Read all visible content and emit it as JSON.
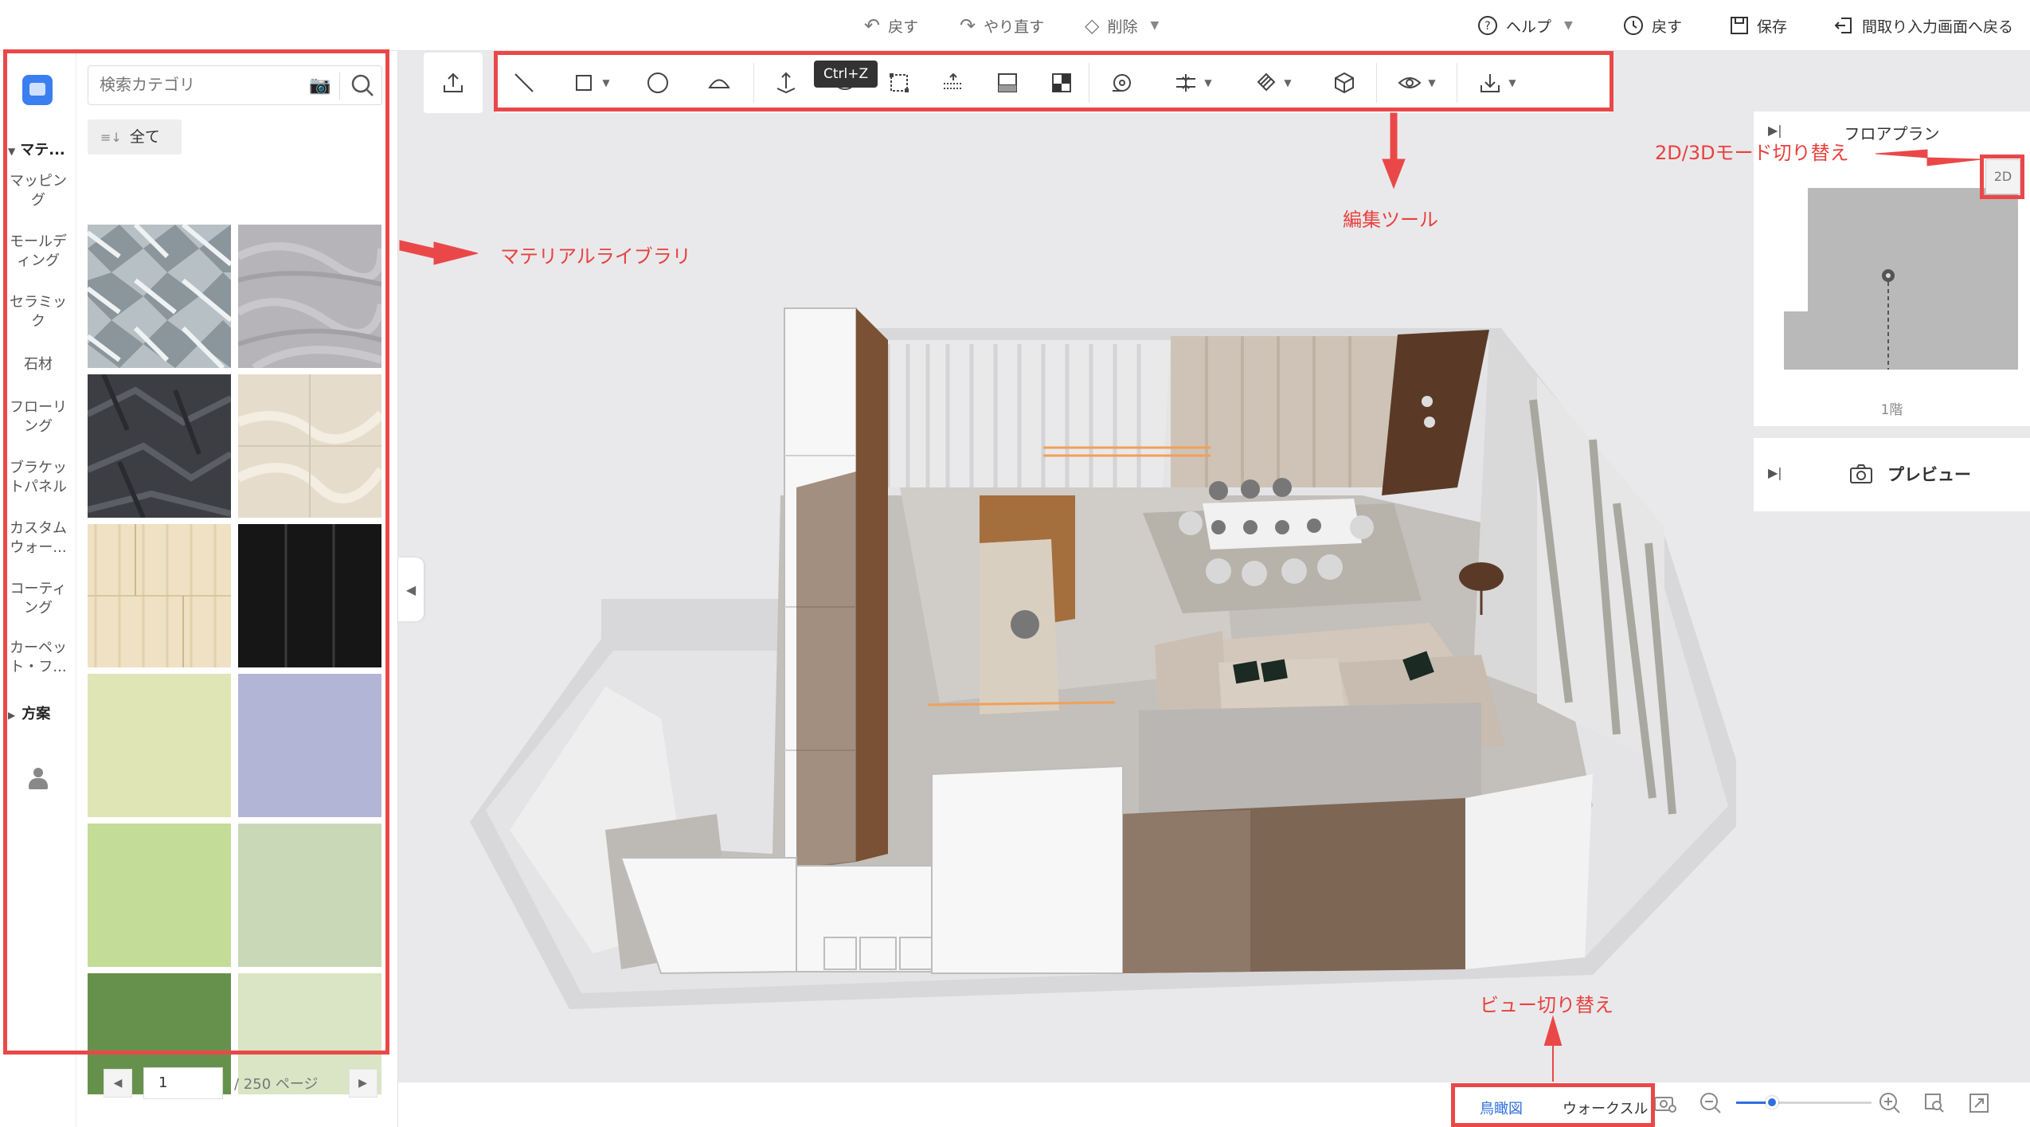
{
  "topbar": {
    "undo": "戻す",
    "redo": "やり直す",
    "delete": "削除",
    "help": "ヘルプ",
    "back": "戻す",
    "save": "保存",
    "return_floorplan": "間取り入力画面へ戻る"
  },
  "sidebar": {
    "section_material": "マテ...",
    "categories": [
      "マッピング",
      "モールディング",
      "セラミック",
      "石材",
      "フローリング",
      "ブラケットパネル",
      "カスタムウォー...",
      "コーティング",
      "カーペット・フ..."
    ],
    "section_plan": "方案",
    "search_placeholder": "検索カテゴリ",
    "filter_all": "全て",
    "swatches": [
      {
        "name": "blue-grey-marble",
        "color": "#aab4b8"
      },
      {
        "name": "grey-granite",
        "color": "#b9b8bc"
      },
      {
        "name": "dark-slate",
        "color": "#3c3e42"
      },
      {
        "name": "beige-marble",
        "color": "#e6dccb"
      },
      {
        "name": "light-wood",
        "color": "#efe0c2"
      },
      {
        "name": "black-panel",
        "color": "#151515"
      },
      {
        "name": "pale-yellow-green",
        "color": "#dfe5b5"
      },
      {
        "name": "lavender",
        "color": "#b3b5d6"
      },
      {
        "name": "light-green",
        "color": "#c3dc98"
      },
      {
        "name": "sage",
        "color": "#c9d9b7"
      },
      {
        "name": "forest-green",
        "color": "#66914d"
      },
      {
        "name": "mint",
        "color": "#d9e5c4"
      }
    ],
    "pager": {
      "page": "1",
      "total": "/ 250 ページ"
    }
  },
  "toolbar": {
    "tooltip": "Ctrl+Z"
  },
  "floorplan": {
    "title": "フロアプラン",
    "mode": "2D",
    "floor": "1階"
  },
  "preview": {
    "label": "プレビュー"
  },
  "bottom": {
    "view_birdseye": "鳥瞰図",
    "view_walkthrough": "ウォークスル"
  },
  "annotations": {
    "material_library": "マテリアルライブラリ",
    "edit_tools": "編集ツール",
    "mode_switch": "2D/3Dモード切り替え",
    "view_switch": "ビュー切り替え"
  },
  "colors": {
    "accent": "#2f6fe0",
    "annotation": "#ea4848"
  }
}
